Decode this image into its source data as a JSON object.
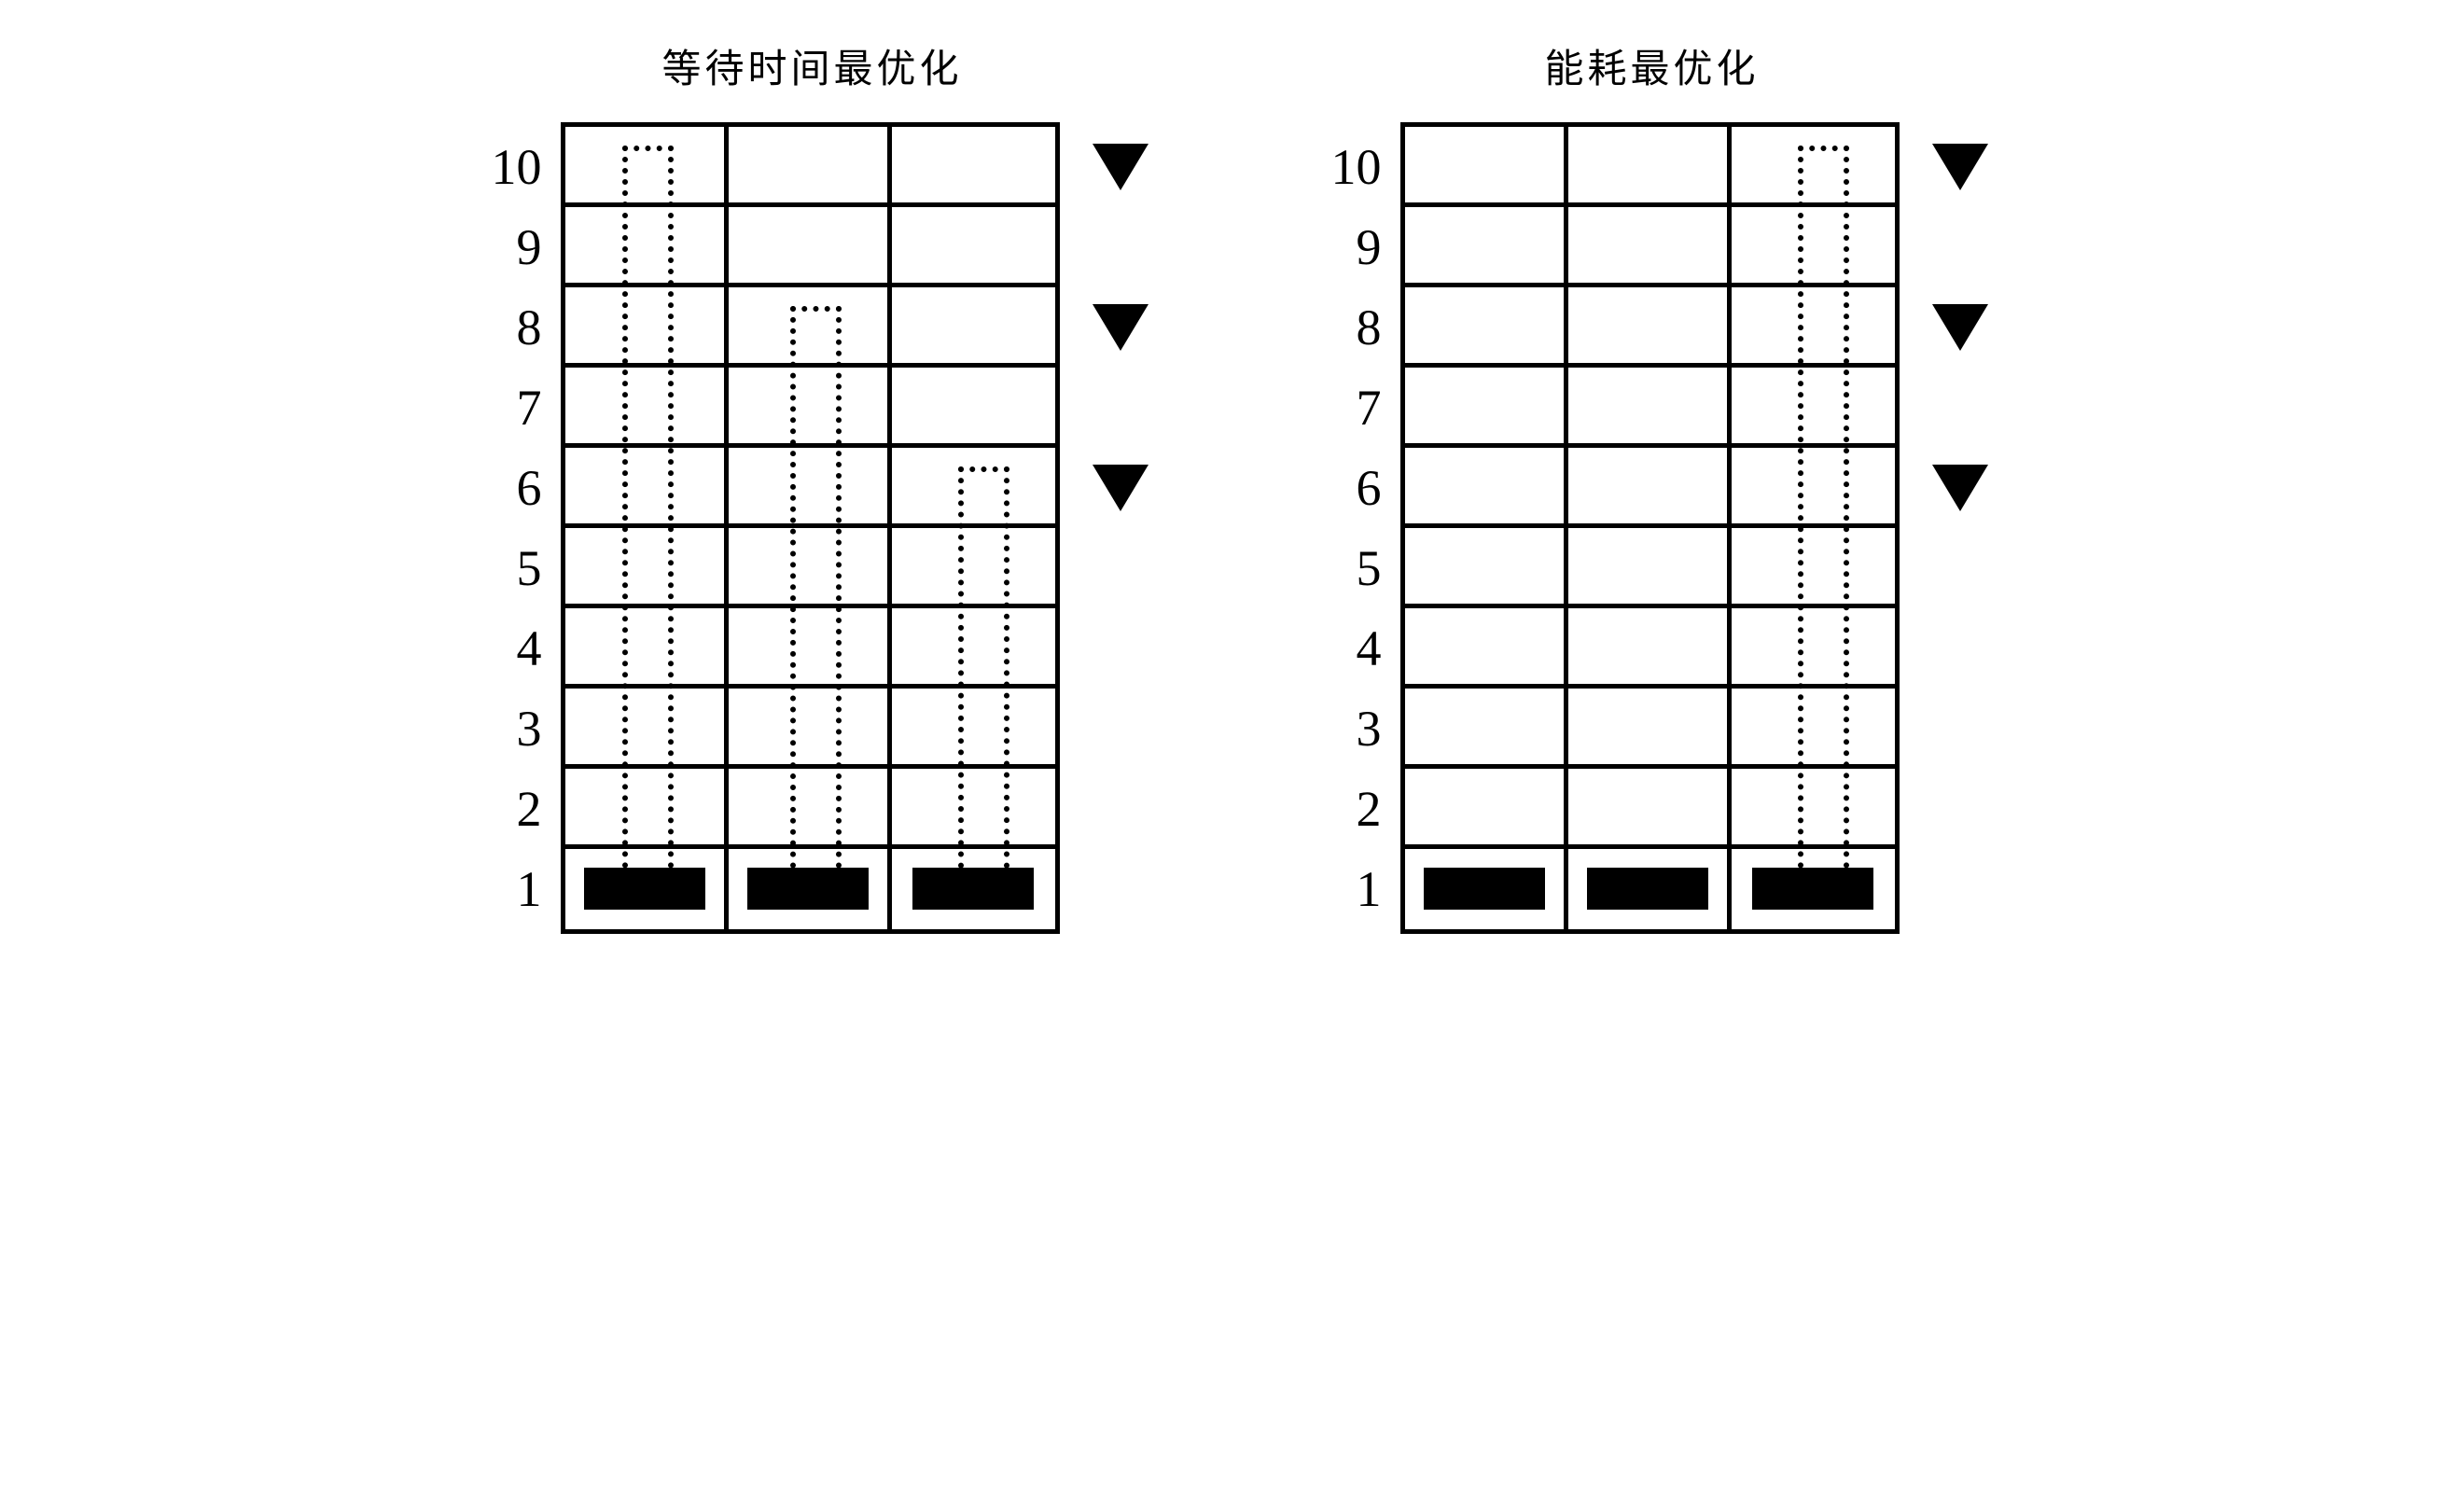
{
  "panels": [
    {
      "title": "等待时间最优化",
      "floors": [
        "10",
        "9",
        "8",
        "7",
        "6",
        "5",
        "4",
        "3",
        "2",
        "1"
      ],
      "columns": 3,
      "elevators": [
        {
          "column": 0,
          "floor": 1
        },
        {
          "column": 1,
          "floor": 1
        },
        {
          "column": 2,
          "floor": 1
        }
      ],
      "paths": [
        {
          "column": 0,
          "from_floor": 1,
          "to_floor": 10
        },
        {
          "column": 1,
          "from_floor": 1,
          "to_floor": 8
        },
        {
          "column": 2,
          "from_floor": 1,
          "to_floor": 6
        }
      ],
      "markers_at_floors": [
        10,
        8,
        6
      ]
    },
    {
      "title": "能耗最优化",
      "floors": [
        "10",
        "9",
        "8",
        "7",
        "6",
        "5",
        "4",
        "3",
        "2",
        "1"
      ],
      "columns": 3,
      "elevators": [
        {
          "column": 0,
          "floor": 1
        },
        {
          "column": 1,
          "floor": 1
        },
        {
          "column": 2,
          "floor": 1
        }
      ],
      "paths": [
        {
          "column": 2,
          "from_floor": 1,
          "to_floor": 10
        }
      ],
      "markers_at_floors": [
        10,
        8,
        6
      ]
    }
  ]
}
